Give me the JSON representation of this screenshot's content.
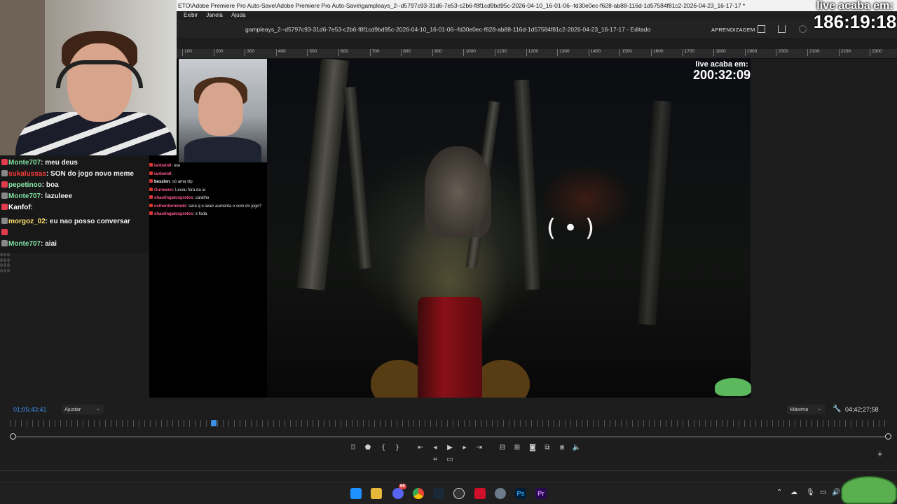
{
  "window": {
    "title": "ETO\\Adobe Premiere Pro Auto-Save\\Adobe Premiere Pro Auto-Save\\gampleays_2--d5797c93-31d6-7e53-c2b6-f8f1cd9bd95c-2026-04-10_16-01-06--fd30e0ec-f628-ab88-116d-1d57584f81c2-2026-04-23_16-17-17 *"
  },
  "menu": {
    "items": [
      "Exibir",
      "Janela",
      "Ajuda"
    ]
  },
  "header": {
    "document_title": "gampleays_2--d5797c93-31d6-7e53-c2b6-f8f1cd9bd95c-2026-04-10_16-01-06--fd30e0ec-f628-ab88-116d-1d57584f81c2-2026-04-23_16-17-17 - Editado",
    "workspace_tab": "APRENDIZAGEM"
  },
  "ruler": {
    "ticks": [
      "100",
      "200",
      "300",
      "400",
      "500",
      "600",
      "700",
      "800",
      "900",
      "1000",
      "1100",
      "1200",
      "1300",
      "1400",
      "1500",
      "1600",
      "1700",
      "1800",
      "1900",
      "2000",
      "2100",
      "2200",
      "2300"
    ]
  },
  "stream_timer": {
    "label": "live acaba em:",
    "value": "186:19:18"
  },
  "inner_timer": {
    "label": "live acaba em:",
    "value": "200:32:09"
  },
  "chat": {
    "messages": [
      {
        "user": "Monte707",
        "text": "meu deus",
        "color": "#7fe0a0"
      },
      {
        "user": "sukalussas",
        "text": "SON do jogo novo meme",
        "color": "#ff3b3b"
      },
      {
        "user": "pepetinoo",
        "text": "boa",
        "color": "#8ff0b0"
      },
      {
        "user": "Monte707",
        "text": "lazuleee",
        "color": "#7fe0a0"
      },
      {
        "user": "Kanfof",
        "text": "",
        "color": "#ffffff"
      },
      {
        "user": "morgoz_02",
        "text": "eu nao posso conversar",
        "color": "#ffe070"
      },
      {
        "user": "",
        "text": "",
        "color": "#ffffff"
      },
      {
        "user": "Monte707",
        "text": "aiai",
        "color": "#7fe0a0"
      }
    ]
  },
  "inner_chat": {
    "messages": [
      {
        "user": "ianbein9",
        "text": "oxe"
      },
      {
        "user": "ianbein9",
        "text": ""
      },
      {
        "user": "bexzinn",
        "text": "só ama vlp"
      },
      {
        "user": "Ourmenn",
        "text": "Levou fora da ia"
      },
      {
        "user": "shaolingatospretos",
        "text": "caralho"
      },
      {
        "user": "estherdormindo",
        "text": "será q o laser aumenta o som do jogo?"
      },
      {
        "user": "shaolingatospretos",
        "text": "e foda"
      }
    ]
  },
  "left_strip": {
    "marks": "0 0 0 0 0 0 0 0 0 0 0 0"
  },
  "playback": {
    "timecode_current": "01;05;43;41",
    "fit_label": "Ajustar",
    "quality_label": "Máxima",
    "timecode_duration": "04;42;27;58",
    "progress_fraction": 0.232
  },
  "icons": {
    "controls": [
      "marker-in-icon",
      "marker-icon",
      "mark-in-icon",
      "mark-out-icon",
      "go-to-in-icon",
      "step-back-icon",
      "play-icon",
      "step-forward-icon",
      "go-to-out-icon",
      "insert-icon",
      "overwrite-icon",
      "export-frame-icon",
      "comparison-icon",
      "multicam-icon",
      "volume-icon"
    ],
    "secondary": [
      "safe-margins-icon",
      "fullscreen-icon"
    ]
  },
  "taskbar": {
    "apps": [
      "windows-start-icon",
      "file-explorer-icon",
      "discord-icon",
      "chrome-icon",
      "steam-icon",
      "obs-icon",
      "recorder-icon",
      "settings-icon",
      "photoshop-icon",
      "premiere-icon"
    ],
    "discord_badge": "69",
    "photoshop_label": "Ps",
    "premiere_label": "Pr"
  },
  "colors": {
    "accent": "#3d8ee8",
    "premiere_purple": "#2a0a4f",
    "background": "#1d1d1d"
  }
}
